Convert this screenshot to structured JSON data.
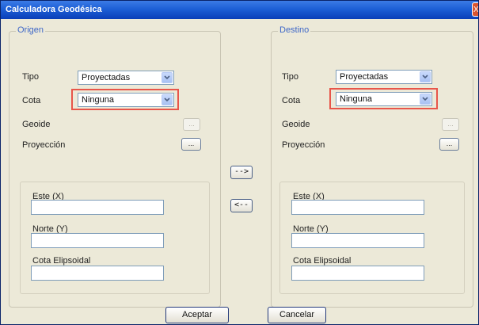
{
  "window": {
    "title": "Calculadora Geodésica",
    "close_label": "X"
  },
  "origen": {
    "legend": "Origen",
    "tipo_label": "Tipo",
    "tipo_value": "Proyectadas",
    "cota_label": "Cota",
    "cota_value": "Ninguna",
    "geoide_label": "Geoide",
    "geoide_button": "...",
    "proyeccion_label": "Proyección",
    "proyeccion_button": "...",
    "este_label": "Este (X)",
    "este_value": "",
    "norte_label": "Norte (Y)",
    "norte_value": "",
    "cota_elip_label": "Cota Elipsoidal",
    "cota_elip_value": ""
  },
  "destino": {
    "legend": "Destino",
    "tipo_label": "Tipo",
    "tipo_value": "Proyectadas",
    "cota_label": "Cota",
    "cota_value": "Ninguna",
    "geoide_label": "Geoide",
    "geoide_button": "...",
    "proyeccion_label": "Proyección",
    "proyeccion_button": "...",
    "este_label": "Este (X)",
    "este_value": "",
    "norte_label": "Norte (Y)",
    "norte_value": "",
    "cota_elip_label": "Cota Elipsoidal",
    "cota_elip_value": ""
  },
  "transfer": {
    "forward": "-->",
    "backward": "<--"
  },
  "buttons": {
    "ok": "Aceptar",
    "cancel": "Cancelar"
  },
  "colors": {
    "highlight": "#e8564a",
    "legend_text": "#3e67c7",
    "titlebar": "#1d5fd6"
  }
}
